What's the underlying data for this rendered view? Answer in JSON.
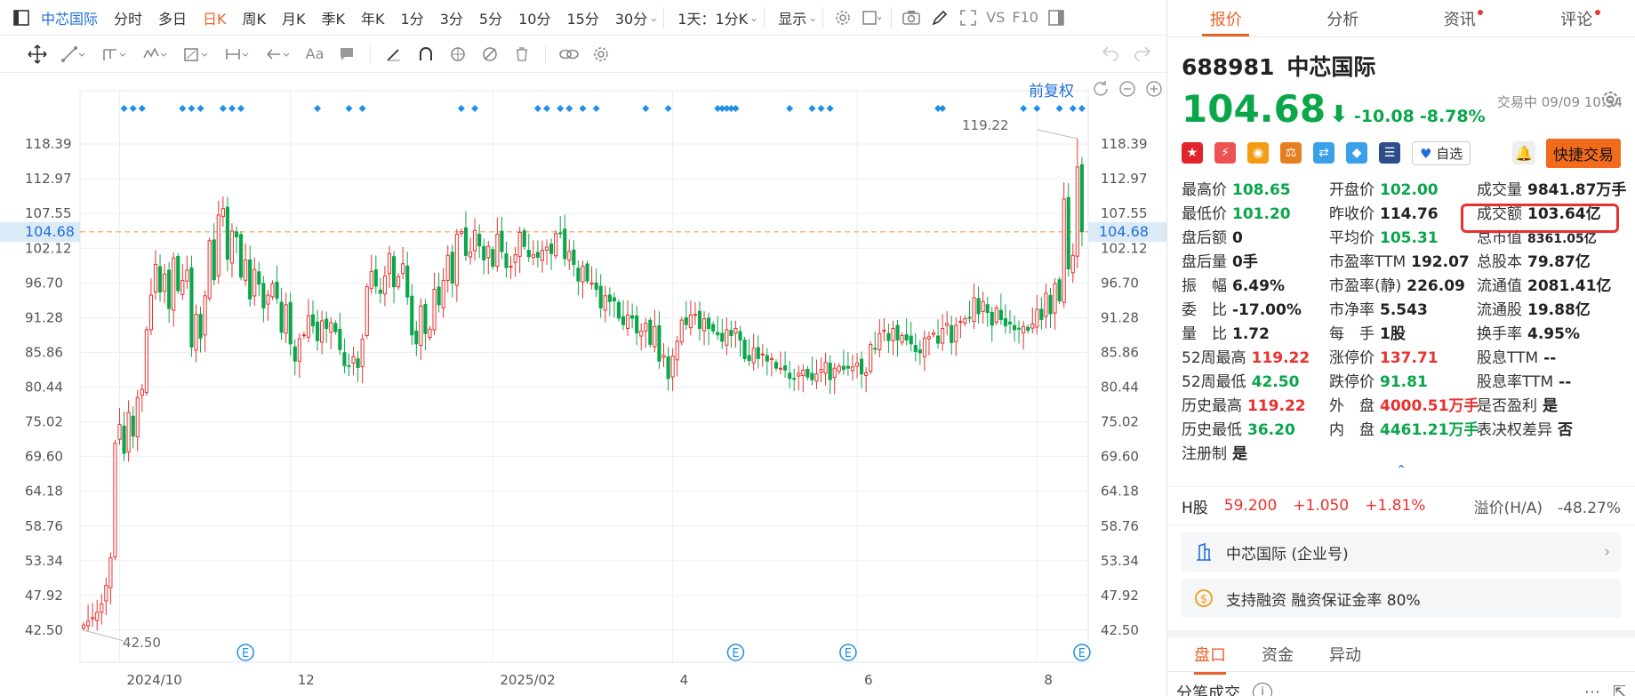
{
  "toolbar": {
    "stock_name": "中芯国际",
    "periods": [
      "分时",
      "多日",
      "日K",
      "周K",
      "月K",
      "季K",
      "年K",
      "1分",
      "3分",
      "5分",
      "10分",
      "15分",
      "30分"
    ],
    "active_period": "日K",
    "range_select": "1天：1分K",
    "display_label": "显示",
    "vs_label": "VS",
    "f10_label": "F10"
  },
  "chart_overlay": {
    "adjust_label": "前复权",
    "current_price_tag": "104.68",
    "max_label": "119.22",
    "min_label": "42.50",
    "event_marker": "E"
  },
  "chart_data": {
    "type": "candlestick",
    "y_ticks": [
      "118.39",
      "112.97",
      "107.55",
      "102.12",
      "96.70",
      "91.28",
      "85.86",
      "80.44",
      "75.02",
      "69.60",
      "64.18",
      "58.76",
      "53.34",
      "47.92",
      "42.50"
    ],
    "ylim": [
      42.5,
      118.39
    ],
    "x_tick_labels": [
      "2024/10",
      "12",
      "2025/02",
      "4",
      "6",
      "8"
    ],
    "current_price": 104.68,
    "period_high": 119.22,
    "period_low": 42.5,
    "e_markers_count": 4,
    "close_series": [
      43.3,
      43.9,
      44.5,
      45.3,
      46.6,
      49.5,
      53.8,
      71.7,
      74.6,
      70.1,
      76.5,
      72.8,
      78.8,
      80.1,
      89.4,
      94.8,
      99.6,
      95.3,
      98.1,
      92.7,
      100.6,
      95.5,
      97.1,
      98.7,
      86.7,
      91.8,
      88.1,
      94.7,
      103.3,
      97.2,
      107.3,
      108.3,
      100.4,
      104.8,
      103.9,
      97.6,
      100.3,
      94.2,
      98.8,
      96.5,
      92.8,
      94.8,
      96.6,
      94.3,
      89.0,
      93.3,
      87.2,
      84.5,
      88.0,
      88.6,
      91.6,
      90.0,
      87.7,
      90.8,
      89.6,
      90.5,
      89.1,
      86.3,
      83.8,
      83.7,
      85.2,
      83.5,
      87.9,
      96.1,
      98.5,
      96.2,
      95.1,
      97.8,
      101.3,
      96.1,
      97.7,
      99.7,
      94.5,
      88.6,
      87.2,
      93.1,
      88.8,
      89.5,
      95.7,
      93.3,
      97.1,
      101.0,
      96.7,
      104.3,
      104.7,
      101.0,
      101.5,
      104.9,
      102.5,
      100.3,
      102.4,
      99.3,
      104.3,
      101.6,
      99.1,
      99.3,
      101.1,
      104.6,
      102.4,
      100.8,
      101.1,
      100.7,
      101.8,
      102.3,
      101.3,
      104.4,
      104.5,
      100.5,
      101.6,
      99.6,
      97.0,
      99.3,
      97.0,
      96.7,
      95.7,
      92.8,
      94.7,
      93.8,
      93.9,
      91.2,
      90.2,
      91.7,
      91.2,
      88.9,
      89.2,
      90.4,
      87.1,
      89.9,
      84.5,
      85.4,
      81.8,
      85.3,
      87.6,
      90.9,
      90.2,
      91.7,
      91.8,
      89.6,
      91.1,
      89.6,
      89.2,
      88.6,
      87.6,
      89.4,
      88.5,
      89.6,
      87.8,
      84.9,
      84.6,
      86.5,
      84.9,
      85.6,
      84.5,
      84.9,
      83.4,
      83.4,
      83.1,
      81.8,
      81.7,
      82.6,
      83.1,
      82.0,
      81.6,
      82.5,
      83.2,
      84.3,
      81.6,
      83.4,
      83.7,
      83.2,
      83.4,
      83.6,
      84.2,
      82.5,
      82.7,
      87.1,
      86.4,
      88.8,
      89.3,
      87.7,
      89.6,
      87.8,
      88.5,
      87.8,
      87.2,
      86.0,
      85.8,
      88.1,
      88.3,
      88.9,
      87.3,
      89.6,
      90.4,
      87.4,
      90.1,
      90.7,
      91.1,
      91.3,
      94.4,
      91.9,
      93.8,
      92.1,
      90.1,
      92.8,
      91.0,
      90.0,
      90.3,
      89.4,
      89.5,
      89.9,
      89.3,
      90.3,
      92.6,
      91.0,
      95.1,
      91.9,
      96.6,
      93.9,
      109.8,
      98.9,
      101.0,
      114.8,
      104.7
    ]
  },
  "quote": {
    "tabs": [
      "报价",
      "分析",
      "资讯",
      "评论"
    ],
    "active_tab": "报价",
    "code": "688981",
    "name": "中芯国际",
    "price": "104.68",
    "change": "-10.08",
    "change_pct": "-8.78%",
    "status": "交易中 09/09 10:54",
    "zixuan_label": "自选",
    "quick_trade": "快捷交易",
    "fields": [
      {
        "label": "最高价",
        "value": "108.65",
        "color": "green"
      },
      {
        "label": "开盘价",
        "value": "102.00",
        "color": "green"
      },
      {
        "label": "成交量",
        "value": "9841.87万手",
        "color": "dark"
      },
      {
        "label": "最低价",
        "value": "101.20",
        "color": "green"
      },
      {
        "label": "昨收价",
        "value": "114.76",
        "color": "dark"
      },
      {
        "label": "成交额",
        "value": "103.64亿",
        "color": "dark"
      },
      {
        "label": "盘后额",
        "value": "0",
        "color": "dark"
      },
      {
        "label": "平均价",
        "value": "105.31",
        "color": "green"
      },
      {
        "label": "总市值",
        "value": "8361.05亿",
        "color": "dark"
      },
      {
        "label": "盘后量",
        "value": "0手",
        "color": "dark"
      },
      {
        "label": "市盈率TTM",
        "value": "192.07",
        "color": "dark"
      },
      {
        "label": "总股本",
        "value": "79.87亿",
        "color": "dark"
      },
      {
        "label": "振　幅",
        "value": "6.49%",
        "color": "dark"
      },
      {
        "label": "市盈率(静)",
        "value": "226.09",
        "color": "dark"
      },
      {
        "label": "流通值",
        "value": "2081.41亿",
        "color": "dark"
      },
      {
        "label": "委　比",
        "value": "-17.00%",
        "color": "dark"
      },
      {
        "label": "市净率",
        "value": "5.543",
        "color": "dark"
      },
      {
        "label": "流通股",
        "value": "19.88亿",
        "color": "dark"
      },
      {
        "label": "量　比",
        "value": "1.72",
        "color": "dark"
      },
      {
        "label": "每　手",
        "value": "1股",
        "color": "dark"
      },
      {
        "label": "换手率",
        "value": "4.95%",
        "color": "dark"
      },
      {
        "label": "52周最高",
        "value": "119.22",
        "color": "red"
      },
      {
        "label": "涨停价",
        "value": "137.71",
        "color": "red"
      },
      {
        "label": "股息TTM",
        "value": "--",
        "color": "dark"
      },
      {
        "label": "52周最低",
        "value": "42.50",
        "color": "green"
      },
      {
        "label": "跌停价",
        "value": "91.81",
        "color": "green"
      },
      {
        "label": "股息率TTM",
        "value": "--",
        "color": "dark"
      },
      {
        "label": "历史最高",
        "value": "119.22",
        "color": "red"
      },
      {
        "label": "外　盘",
        "value": "4000.51万手",
        "color": "red"
      },
      {
        "label": "是否盈利",
        "value": "是",
        "color": "dark"
      },
      {
        "label": "历史最低",
        "value": "36.20",
        "color": "green"
      },
      {
        "label": "内　盘",
        "value": "4461.21万手",
        "color": "green"
      },
      {
        "label": "表决权差异",
        "value": "否",
        "color": "dark"
      },
      {
        "label": "注册制",
        "value": "是",
        "color": "dark"
      }
    ],
    "hk_label": "H股",
    "hk_price": "59.200",
    "hk_change": "+1.050",
    "hk_change_pct": "+1.81%",
    "premium": "溢价(H/A)　-48.27%",
    "company_card": "中芯国际 (企业号)",
    "margin_card": "支持融资 融资保证金率 80%",
    "bottom_tabs": [
      "盘口",
      "资金",
      "异动"
    ],
    "active_bottom_tab": "盘口",
    "ticks_title": "分笔成交"
  },
  "colors": {
    "up": "#e8322f",
    "down": "#0aa64a",
    "accent": "#e8632a",
    "link": "#1f6fd8"
  }
}
